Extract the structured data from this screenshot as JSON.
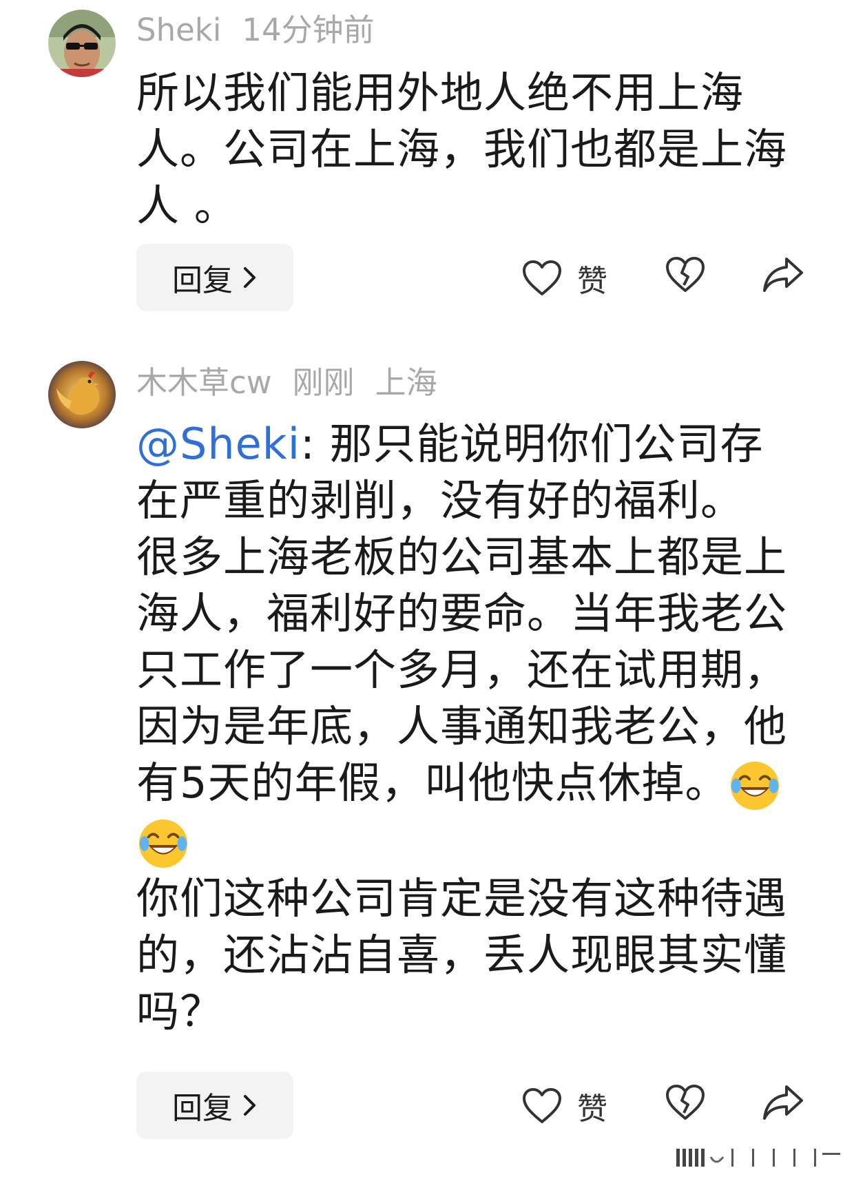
{
  "comments": [
    {
      "username": "Sheki",
      "time": "14分钟前",
      "location": "",
      "body": "所以我们能用外地人绝不用上海人。公司在上海，我们也都是上海人 。",
      "reply_label": "回复",
      "like_label": "赞"
    },
    {
      "username": "木木草cw",
      "time": "刚刚",
      "location": "上海",
      "mention": "@Sheki",
      "body_p1": ": 那只能说明你们公司存在严重的剥削，没有好的福利。",
      "body_p2": "很多上海老板的公司基本上都是上海人，福利好的要命。当年我老公只工作了一个多月，还在试用期，因为是年底，人事通知我老公，他有5天的年假，叫他快点休掉。",
      "body_p3": "你们这种公司肯定是没有这种待遇的，还沾沾自喜，丢人现眼其实懂吗？",
      "emoji": "laughing-crying",
      "reply_label": "回复",
      "like_label": "赞"
    }
  ],
  "colors": {
    "meta": "#a8a8a8",
    "mention": "#2f6fd6",
    "button_bg": "#f3f3f3"
  }
}
